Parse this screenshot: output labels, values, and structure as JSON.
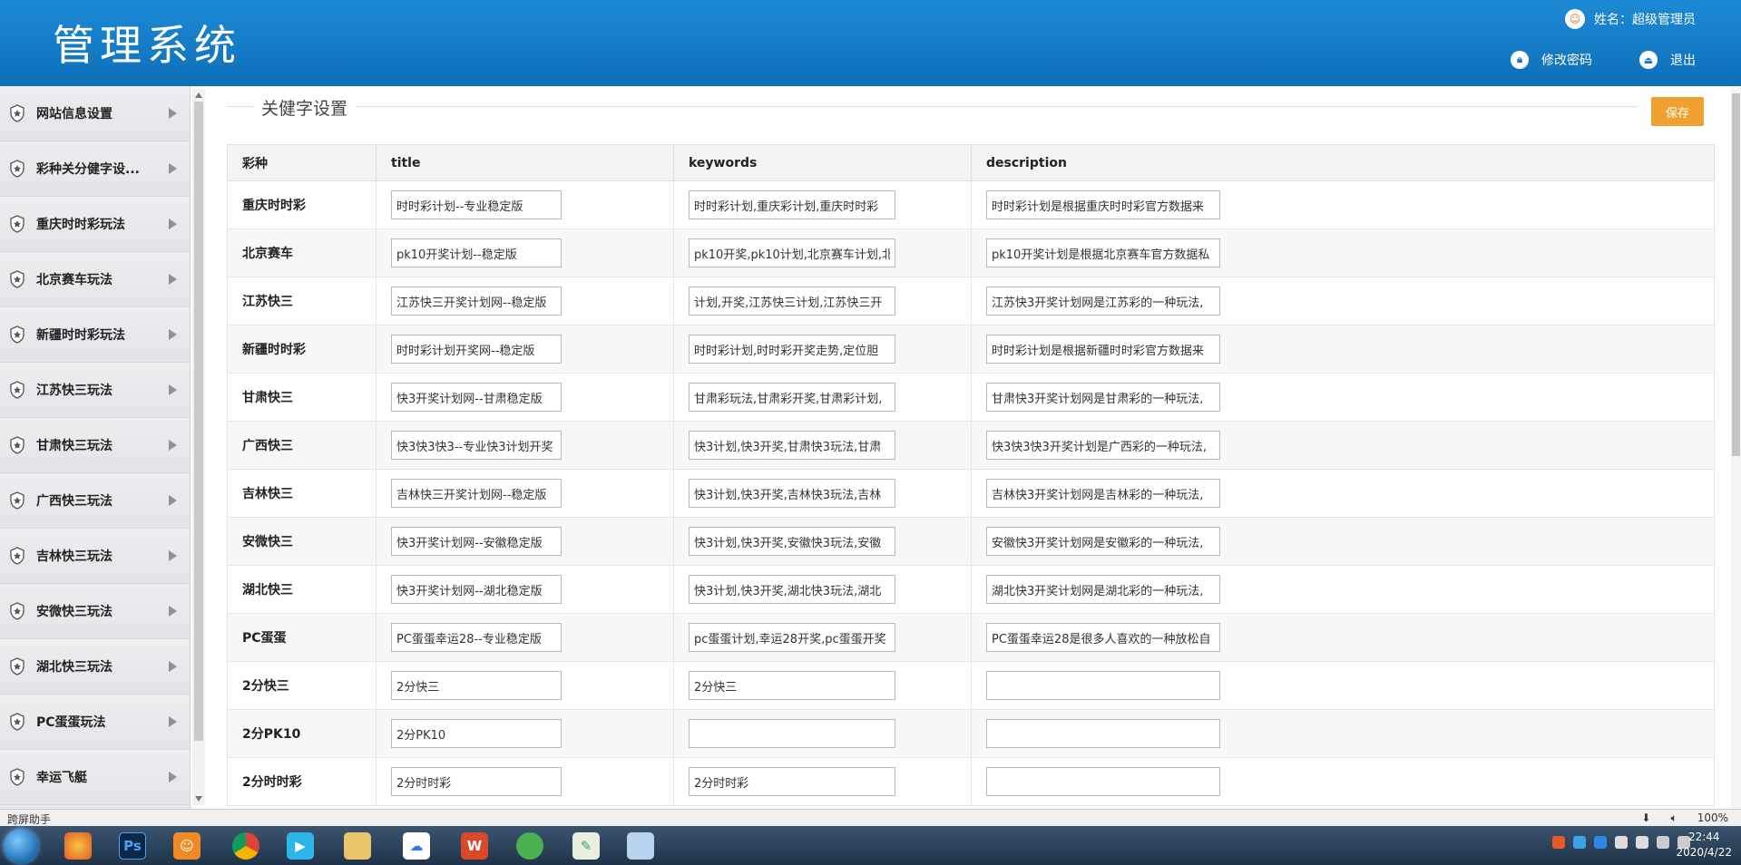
{
  "header": {
    "logo": "管理系统",
    "user_label": "姓名：超级管理员",
    "change_password": "修改密码",
    "logout": "退出"
  },
  "sidebar": {
    "items": [
      {
        "label": "网站信息设置"
      },
      {
        "label": "彩种关分健字设..."
      },
      {
        "label": "重庆时时彩玩法"
      },
      {
        "label": "北京赛车玩法"
      },
      {
        "label": "新疆时时彩玩法"
      },
      {
        "label": "江苏快三玩法"
      },
      {
        "label": "甘肃快三玩法"
      },
      {
        "label": "广西快三玩法"
      },
      {
        "label": "吉林快三玩法"
      },
      {
        "label": "安微快三玩法"
      },
      {
        "label": "湖北快三玩法"
      },
      {
        "label": "PC蛋蛋玩法"
      },
      {
        "label": "幸运飞艇"
      }
    ]
  },
  "main": {
    "section_title": "关健字设置",
    "save_label": "保存",
    "columns": [
      "彩种",
      "title",
      "keywords",
      "description"
    ],
    "rows": [
      {
        "name": "重庆时时彩",
        "title": "时时彩计划--专业稳定版",
        "keywords": "时时彩计划,重庆彩计划,重庆时时彩",
        "description": "时时彩计划是根据重庆时时彩官方数据来"
      },
      {
        "name": "北京赛车",
        "title": "pk10开奖计划--稳定版",
        "keywords": "pk10开奖,pk10计划,北京赛车计划,北",
        "description": "pk10开奖计划是根据北京赛车官方数据私"
      },
      {
        "name": "江苏快三",
        "title": "江苏快三开奖计划网--稳定版",
        "keywords": "计划,开奖,江苏快三计划,江苏快三开",
        "description": "江苏快3开奖计划网是江苏彩的一种玩法,"
      },
      {
        "name": "新疆时时彩",
        "title": "时时彩计划开奖网--稳定版",
        "keywords": "时时彩计划,时时彩开奖走势,定位胆",
        "description": "时时彩计划是根据新疆时时彩官方数据来"
      },
      {
        "name": "甘肃快三",
        "title": "快3开奖计划网--甘肃稳定版",
        "keywords": "甘肃彩玩法,甘肃彩开奖,甘肃彩计划,",
        "description": "甘肃快3开奖计划网是甘肃彩的一种玩法,"
      },
      {
        "name": "广西快三",
        "title": "快3快3快3--专业快3计划开奖",
        "keywords": "快3计划,快3开奖,甘肃快3玩法,甘肃",
        "description": "快3快3快3开奖计划是广西彩的一种玩法,"
      },
      {
        "name": "吉林快三",
        "title": "吉林快三开奖计划网--稳定版",
        "keywords": "快3计划,快3开奖,吉林快3玩法,吉林",
        "description": "吉林快3开奖计划网是吉林彩的一种玩法,"
      },
      {
        "name": "安微快三",
        "title": "快3开奖计划网--安徽稳定版",
        "keywords": "快3计划,快3开奖,安徽快3玩法,安徽",
        "description": "安徽快3开奖计划网是安徽彩的一种玩法,"
      },
      {
        "name": "湖北快三",
        "title": "快3开奖计划网--湖北稳定版",
        "keywords": "快3计划,快3开奖,湖北快3玩法,湖北",
        "description": "湖北快3开奖计划网是湖北彩的一种玩法,"
      },
      {
        "name": "PC蛋蛋",
        "title": "PC蛋蛋幸运28--专业稳定版",
        "keywords": "pc蛋蛋计划,幸运28开奖,pc蛋蛋开奖",
        "description": "PC蛋蛋幸运28是很多人喜欢的一种放松自"
      },
      {
        "name": "2分快三",
        "title": "2分快三",
        "keywords": "2分快三",
        "description": ""
      },
      {
        "name": "2分PK10",
        "title": "2分PK10",
        "keywords": "",
        "description": ""
      },
      {
        "name": "2分时时彩",
        "title": "2分时时彩",
        "keywords": "2分时时彩",
        "description": ""
      }
    ]
  },
  "statusbar": {
    "left": "跨屏助手",
    "zoom": "100%"
  },
  "taskbar": {
    "apps": [
      "chrome-like-icon",
      "photoshop-icon",
      "uc-browser-icon",
      "chrome-icon",
      "media-player-icon",
      "file-explorer-icon",
      "baidu-netdisk-icon",
      "wps-icon",
      "green-app-icon",
      "notepad-icon",
      "window-icon"
    ],
    "ps_label": "Ps",
    "time": "22:44",
    "date": "2020/4/22"
  },
  "colors": {
    "header_blue": "#1377c1",
    "save_orange": "#f0a030"
  }
}
